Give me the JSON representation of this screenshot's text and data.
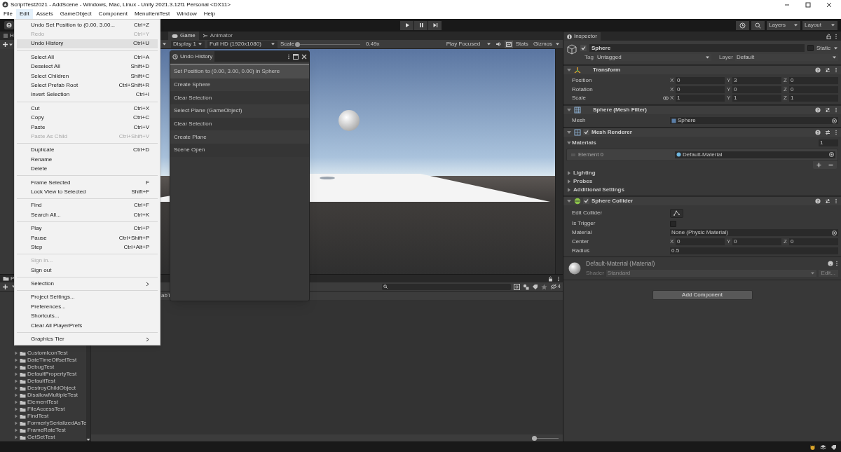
{
  "window": {
    "title": "ScriptTest2021 - AddScene - Windows, Mac, Linux - Unity 2021.3.12f1 Personal <DX11>"
  },
  "menu_bar": [
    {
      "label": "File",
      "selected": false
    },
    {
      "label": "Edit",
      "selected": true
    },
    {
      "label": "Assets",
      "selected": false
    },
    {
      "label": "GameObject",
      "selected": false
    },
    {
      "label": "Component",
      "selected": false
    },
    {
      "label": "MenuItemTest",
      "selected": false
    },
    {
      "label": "Window",
      "selected": false
    },
    {
      "label": "Help",
      "selected": false
    }
  ],
  "edit_menu": [
    {
      "kind": "item",
      "label": "Undo Set Position to (0.00, 3.00...",
      "shortcut": "Ctrl+Z",
      "disabled": false,
      "selected": false
    },
    {
      "kind": "item",
      "label": "Redo",
      "shortcut": "Ctrl+Y",
      "disabled": true,
      "selected": false
    },
    {
      "kind": "item",
      "label": "Undo History",
      "shortcut": "Ctrl+U",
      "disabled": false,
      "selected": true
    },
    {
      "kind": "separator"
    },
    {
      "kind": "item",
      "label": "Select All",
      "shortcut": "Ctrl+A",
      "disabled": false,
      "selected": false
    },
    {
      "kind": "item",
      "label": "Deselect All",
      "shortcut": "Shift+D",
      "disabled": false,
      "selected": false
    },
    {
      "kind": "item",
      "label": "Select Children",
      "shortcut": "Shift+C",
      "disabled": false,
      "selected": false
    },
    {
      "kind": "item",
      "label": "Select Prefab Root",
      "shortcut": "Ctrl+Shift+R",
      "disabled": false,
      "selected": false
    },
    {
      "kind": "item",
      "label": "Invert Selection",
      "shortcut": "Ctrl+I",
      "disabled": false,
      "selected": false
    },
    {
      "kind": "separator"
    },
    {
      "kind": "item",
      "label": "Cut",
      "shortcut": "Ctrl+X",
      "disabled": false,
      "selected": false
    },
    {
      "kind": "item",
      "label": "Copy",
      "shortcut": "Ctrl+C",
      "disabled": false,
      "selected": false
    },
    {
      "kind": "item",
      "label": "Paste",
      "shortcut": "Ctrl+V",
      "disabled": false,
      "selected": false
    },
    {
      "kind": "item",
      "label": "Paste As Child",
      "shortcut": "Ctrl+Shift+V",
      "disabled": true,
      "selected": false
    },
    {
      "kind": "separator"
    },
    {
      "kind": "item",
      "label": "Duplicate",
      "shortcut": "Ctrl+D",
      "disabled": false,
      "selected": false
    },
    {
      "kind": "item",
      "label": "Rename",
      "disabled": false,
      "selected": false
    },
    {
      "kind": "item",
      "label": "Delete",
      "disabled": false,
      "selected": false
    },
    {
      "kind": "separator"
    },
    {
      "kind": "item",
      "label": "Frame Selected",
      "shortcut": "F",
      "disabled": false,
      "selected": false
    },
    {
      "kind": "item",
      "label": "Lock View to Selected",
      "shortcut": "Shift+F",
      "disabled": false,
      "selected": false
    },
    {
      "kind": "separator"
    },
    {
      "kind": "item",
      "label": "Find",
      "shortcut": "Ctrl+F",
      "disabled": false,
      "selected": false
    },
    {
      "kind": "item",
      "label": "Search All...",
      "shortcut": "Ctrl+K",
      "disabled": false,
      "selected": false
    },
    {
      "kind": "separator"
    },
    {
      "kind": "item",
      "label": "Play",
      "shortcut": "Ctrl+P",
      "disabled": false,
      "selected": false
    },
    {
      "kind": "item",
      "label": "Pause",
      "shortcut": "Ctrl+Shift+P",
      "disabled": false,
      "selected": false
    },
    {
      "kind": "item",
      "label": "Step",
      "shortcut": "Ctrl+Alt+P",
      "disabled": false,
      "selected": false
    },
    {
      "kind": "separator"
    },
    {
      "kind": "item",
      "label": "Sign in...",
      "disabled": true,
      "selected": false
    },
    {
      "kind": "item",
      "label": "Sign out",
      "disabled": false,
      "selected": false
    },
    {
      "kind": "separator"
    },
    {
      "kind": "submenu",
      "label": "Selection",
      "disabled": false,
      "selected": false
    },
    {
      "kind": "separator"
    },
    {
      "kind": "item",
      "label": "Project Settings...",
      "disabled": false,
      "selected": false
    },
    {
      "kind": "item",
      "label": "Preferences...",
      "disabled": false,
      "selected": false
    },
    {
      "kind": "item",
      "label": "Shortcuts...",
      "disabled": false,
      "selected": false
    },
    {
      "kind": "item",
      "label": "Clear All PlayerPrefs",
      "disabled": false,
      "selected": false
    },
    {
      "kind": "separator"
    },
    {
      "kind": "submenu",
      "label": "Graphics Tier",
      "disabled": false,
      "selected": false
    }
  ],
  "toolbar": {
    "layers": "Layers",
    "layout": "Layout"
  },
  "hierarchy": {
    "tab": "H"
  },
  "game": {
    "tabs": [
      {
        "label": "Game",
        "selected": true
      },
      {
        "label": "Animator",
        "selected": false
      }
    ],
    "display": "Display 1",
    "resolution": "Full HD (1920x1080)",
    "scale_label": "Scale",
    "scale": {
      "level": 0
    },
    "scale_value": "0.49x",
    "play_mode": "Play Focused",
    "stats": "Stats",
    "gizmos": "Gizmos"
  },
  "undo_history": {
    "title": "Undo History",
    "items": [
      {
        "label": "Set Position to (0.00, 3.00, 0.00) in Sphere",
        "selected": true
      },
      {
        "label": "Create Sphere",
        "selected": false
      },
      {
        "label": "Clear Selection",
        "selected": false
      },
      {
        "label": "Select Plane (GameObject)",
        "selected": false
      },
      {
        "label": "Clear Selection",
        "selected": false
      },
      {
        "label": "Create Plane",
        "selected": false
      },
      {
        "label": "Scene Open",
        "selected": false
      }
    ]
  },
  "project": {
    "tab": "P",
    "breadcrumb": "abT",
    "hidden_count": "4",
    "zoom": {
      "level": 0
    },
    "folders": [
      "CustomIconTest",
      "DateTimeOffsetTest",
      "DebugTest",
      "DefaultPropertyTest",
      "DefaultTest",
      "DestroyChildObject",
      "DisallowMultipleTest",
      "ElementTest",
      "FileAccessTest",
      "FindTest",
      "FormerlySerializedAsTe",
      "FrameRateTest",
      "GetSetTest"
    ]
  },
  "inspector": {
    "title": "Inspector",
    "object": {
      "active": true,
      "name": "Sphere",
      "static": false,
      "static_label": "Static",
      "tag_label": "Tag",
      "tag": "Untagged",
      "layer_label": "Layer",
      "layer": "Default"
    },
    "components": [
      {
        "kind": "transform",
        "title": "Transform",
        "fields": [
          {
            "kind": "vector",
            "label": "Position",
            "values": [
              {
                "axis": "X",
                "value": "0"
              },
              {
                "axis": "Y",
                "value": "3"
              },
              {
                "axis": "Z",
                "value": "0"
              }
            ]
          },
          {
            "kind": "vector",
            "label": "Rotation",
            "values": [
              {
                "axis": "X",
                "value": "0"
              },
              {
                "axis": "Y",
                "value": "0"
              },
              {
                "axis": "Z",
                "value": "0"
              }
            ]
          },
          {
            "kind": "vector",
            "label": "Scale",
            "link_icon": true,
            "values": [
              {
                "axis": "X",
                "value": "1"
              },
              {
                "axis": "Y",
                "value": "1"
              },
              {
                "axis": "Z",
                "value": "1"
              }
            ]
          }
        ]
      },
      {
        "kind": "mesh_filter",
        "title": "Sphere (Mesh Filter)",
        "fields": [
          {
            "kind": "mesh_object",
            "label": "Mesh",
            "value": "Sphere"
          }
        ]
      },
      {
        "kind": "mesh_renderer",
        "title": "Mesh Renderer",
        "enabled": true,
        "fields": [
          {
            "kind": "array",
            "label": "Materials",
            "count": "1",
            "elements": [
              {
                "kind": "material",
                "label": "Element 0",
                "value": "Default-Material"
              }
            ]
          },
          {
            "kind": "foldout",
            "label": "Lighting"
          },
          {
            "kind": "foldout",
            "label": "Probes"
          },
          {
            "kind": "foldout",
            "label": "Additional Settings"
          }
        ]
      },
      {
        "kind": "collider",
        "title": "Sphere Collider",
        "enabled": true,
        "fields": [
          {
            "kind": "button",
            "label": "Edit Collider"
          },
          {
            "kind": "checkbox",
            "label": "Is Trigger",
            "checked": false
          },
          {
            "kind": "object",
            "label": "Material",
            "value": "None (Physic Material)"
          },
          {
            "kind": "vector",
            "label": "Center",
            "values": [
              {
                "axis": "X",
                "value": "0"
              },
              {
                "axis": "Y",
                "value": "0"
              },
              {
                "axis": "Z",
                "value": "0"
              }
            ]
          },
          {
            "kind": "text",
            "label": "Radius",
            "value": "0.5"
          }
        ]
      }
    ],
    "material": {
      "title": "Default-Material (Material)",
      "shader_label": "Shader",
      "shader": "Standard",
      "edit": "Edit..."
    },
    "add_component": "Add Component"
  }
}
